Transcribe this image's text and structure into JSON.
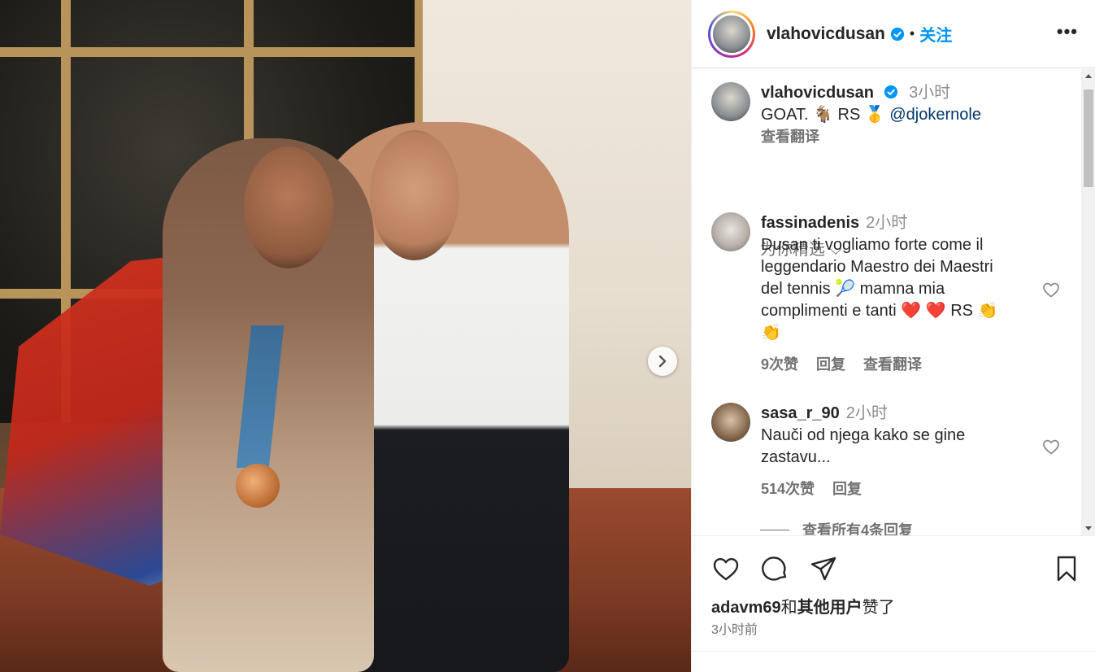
{
  "post": {
    "username": "vlahovicdusan",
    "follow_label": "关注",
    "dot": "•",
    "more": "•••"
  },
  "caption": {
    "username": "vlahovicdusan",
    "time": "3小时",
    "text": "GOAT. 🐐 RS 🥇",
    "mention": "@djokernole",
    "translate": "查看翻译"
  },
  "for_you": "为你精选 ⌵",
  "comments": [
    {
      "username": "fassinadenis",
      "time": "2小时",
      "lines": [
        "Dusan ti vogliamo forte come il",
        "leggendario Maestro dei Maestri",
        "del tennis 🎾  mamna mia",
        "complimenti e tanti  ❤️ ❤️ RS 👏",
        "👏"
      ],
      "likes": "9次赞",
      "reply": "回复",
      "translate": "查看翻译"
    },
    {
      "username": "sasa_r_90",
      "time": "2小时",
      "lines": [
        "Nauči od njega kako se gine",
        "zastavu..."
      ],
      "likes": "514次赞",
      "reply": "回复"
    }
  ],
  "view_replies": "查看所有4条回复",
  "liked_by": {
    "user": "adavm69",
    "and": "和",
    "others": "其他用户",
    "suffix": "赞了"
  },
  "time_ago": "3小时前",
  "icons": [
    "heart-icon",
    "comment-icon",
    "share-icon",
    "bookmark-icon",
    "chevron-right-icon",
    "more-icon",
    "verified-icon"
  ],
  "colors": {
    "accent": "#0095f6",
    "verified": "#0095f6",
    "muted": "#737373"
  }
}
